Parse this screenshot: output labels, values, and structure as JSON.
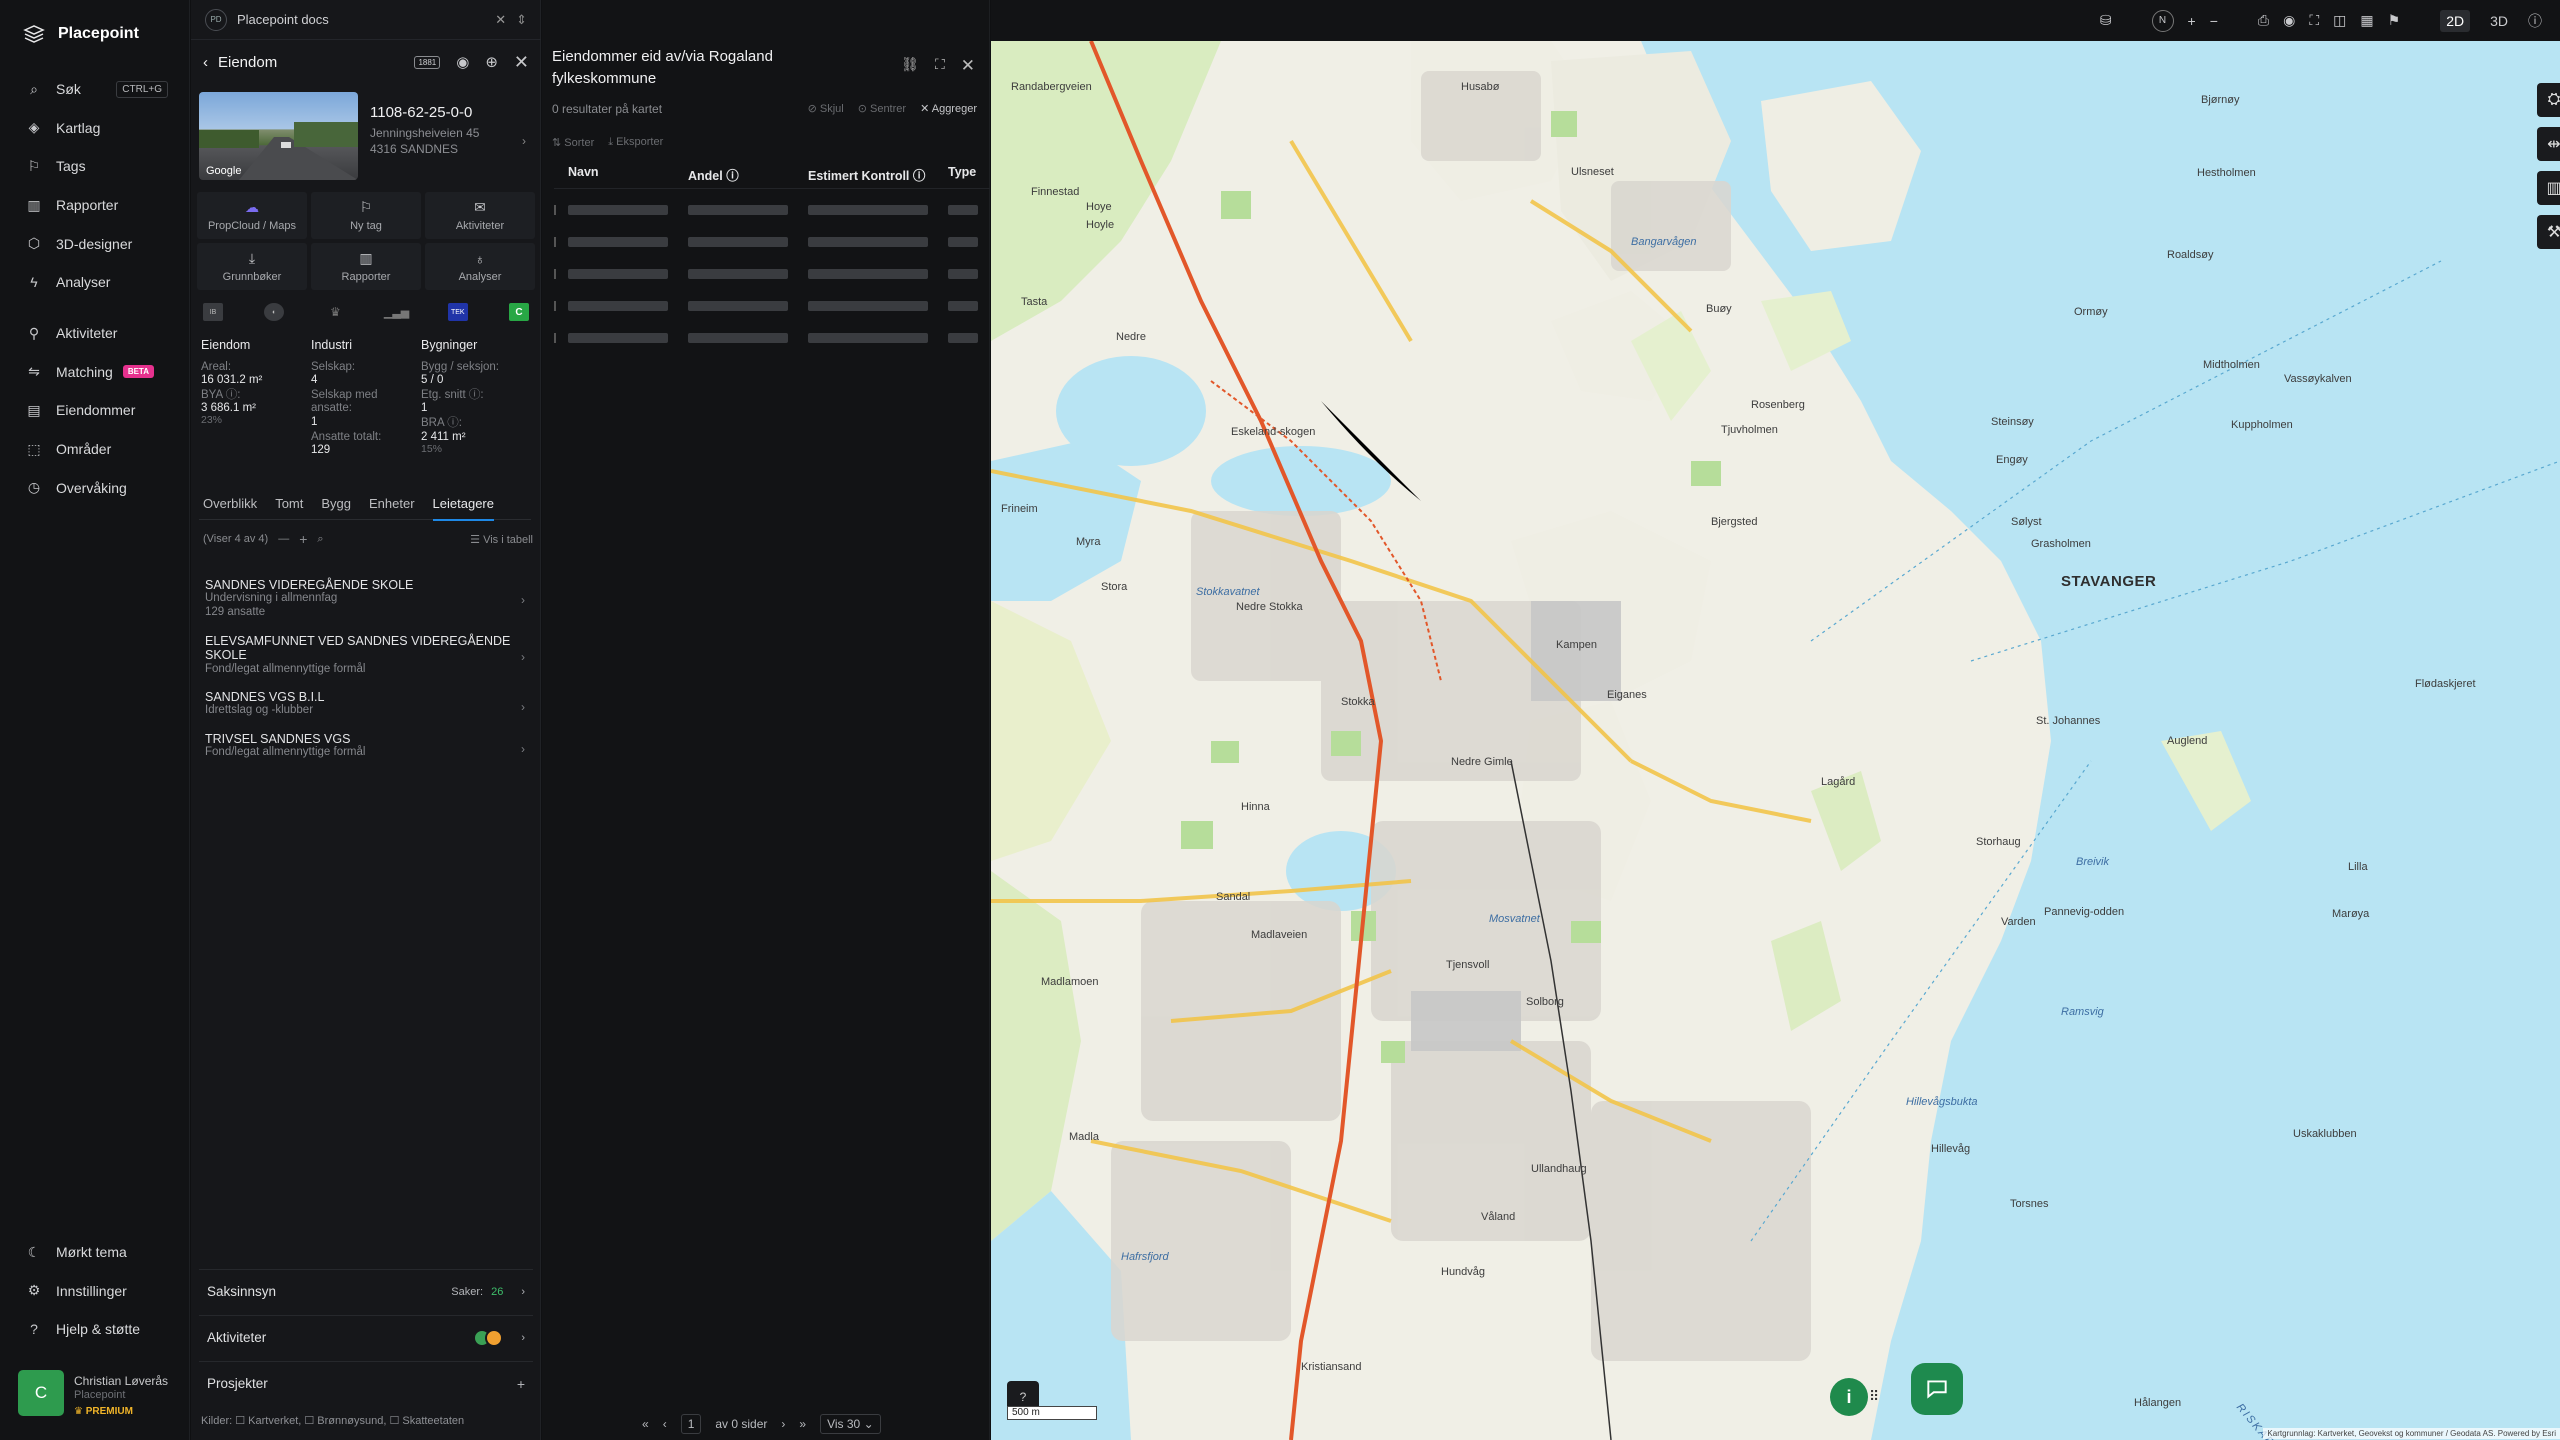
{
  "brand": "Placepoint",
  "nav": {
    "top": [
      {
        "label": "Søk",
        "icon": "search-icon",
        "kbd": "CTRL+G"
      },
      {
        "label": "Kartlag",
        "icon": "layers-icon"
      },
      {
        "label": "Tags",
        "icon": "bookmark-icon"
      },
      {
        "label": "Rapporter",
        "icon": "chart-icon"
      },
      {
        "label": "3D-designer",
        "icon": "cube-icon"
      },
      {
        "label": "Analyser",
        "icon": "bolt-icon"
      }
    ],
    "mid": [
      {
        "label": "Aktiviteter",
        "icon": "activity-icon"
      },
      {
        "label": "Matching",
        "icon": "matching-icon",
        "badge": "BETA"
      },
      {
        "label": "Eiendommer",
        "icon": "building-icon"
      },
      {
        "label": "Områder",
        "icon": "area-icon"
      },
      {
        "label": "Overvåking",
        "icon": "monitor-icon"
      }
    ],
    "bottom": [
      {
        "label": "Mørkt tema",
        "icon": "moon-icon"
      },
      {
        "label": "Innstillinger",
        "icon": "gear-icon"
      },
      {
        "label": "Hjelp & støtte",
        "icon": "help-icon"
      }
    ]
  },
  "user": {
    "initial": "C",
    "name": "Christian Løverås",
    "org": "Placepoint",
    "plan": "PREMIUM"
  },
  "docs": {
    "badge": "PD",
    "title": "Placepoint docs"
  },
  "property": {
    "header": "Eiendom",
    "badge_1881": "1881",
    "photo_label": "Google",
    "id": "1108-62-25-0-0",
    "street": "Jenningsheiveien 45",
    "postal": "4316 SANDNES",
    "tiles": [
      {
        "label": "PropCloud / Maps",
        "icon": "cloud-icon"
      },
      {
        "label": "Ny tag",
        "icon": "bookmark-icon"
      },
      {
        "label": "Aktiviteter",
        "icon": "chat-icon"
      },
      {
        "label": "Grunnbøker",
        "icon": "download-icon"
      },
      {
        "label": "Rapporter",
        "icon": "chart-icon"
      },
      {
        "label": "Analyser",
        "icon": "bulb-icon"
      }
    ],
    "src_tek": "TEK",
    "src_c": "C",
    "stats": {
      "eiendom": {
        "title": "Eiendom",
        "areal_lbl": "Areal:",
        "areal": "16 031.2 m²",
        "bya_lbl": "BYA ⓘ:",
        "bya": "3 686.1 m²",
        "bya_pct": "23%"
      },
      "industri": {
        "title": "Industri",
        "selskap_lbl": "Selskap:",
        "selskap": "4",
        "ansatte_lbl": "Selskap med ansatte:",
        "ansatte": "1",
        "totalt_lbl": "Ansatte totalt:",
        "totalt": "129"
      },
      "bygninger": {
        "title": "Bygninger",
        "bygg_lbl": "Bygg / seksjon:",
        "bygg": "5 / 0",
        "etg_lbl": "Etg. snitt ⓘ:",
        "etg": "1",
        "bra_lbl": "BRA ⓘ:",
        "bra": "2 411 m²",
        "bra_pct": "15%"
      }
    },
    "tabs": [
      "Overblikk",
      "Tomt",
      "Bygg",
      "Enheter",
      "Leietagere"
    ],
    "showing": "(Viser 4 av 4)",
    "show_table": "Vis i tabell",
    "tenants": [
      {
        "name": "SANDNES VIDEREGÅENDE SKOLE",
        "desc": "Undervisning i allmennfag",
        "extra": "129 ansatte"
      },
      {
        "name": "ELEVSAMFUNNET VED SANDNES VIDEREGÅENDE SKOLE",
        "desc": "Fond/legat allmennyttige formål",
        "extra": ""
      },
      {
        "name": "SANDNES VGS B.I.L",
        "desc": "Idrettslag og -klubber",
        "extra": ""
      },
      {
        "name": "TRIVSEL SANDNES VGS",
        "desc": "Fond/legat allmennyttige formål",
        "extra": ""
      }
    ],
    "sections": {
      "saksinnsyn": "Saksinnsyn",
      "saker_lbl": "Saker:",
      "saker": "26",
      "aktiviteter": "Aktiviteter",
      "prosjekter": "Prosjekter"
    },
    "sources": "Kilder: ☐ Kartverket, ☐ Brønnøysund, ☐ Skatteetaten"
  },
  "list": {
    "title": "Eiendommer eid av/via Rogaland fylkeskommune",
    "count": "0 resultater på kartet",
    "hide": "Skjul",
    "center": "Sentrer",
    "aggregate": "Aggreger",
    "sort": "Sorter",
    "export": "Eksporter",
    "columns": [
      "Navn",
      "Andel ⓘ",
      "Estimert Kontroll ⓘ",
      "Type"
    ],
    "pager": {
      "page": "1",
      "of": "av 0 sider",
      "show": "Vis 30"
    }
  },
  "map": {
    "labels": [
      {
        "t": "Randabergveien"
      },
      {
        "t": "Hoye"
      },
      {
        "t": "Finnestad"
      },
      {
        "t": "Hoyle"
      },
      {
        "t": "Tasta"
      },
      {
        "t": "Nedre"
      },
      {
        "t": "Eskeland-skogen"
      },
      {
        "t": "Myra"
      },
      {
        "t": "Frineim"
      },
      {
        "t": "Stora"
      },
      {
        "t": "Stokkavatnet"
      },
      {
        "t": "Nedre Stokka"
      },
      {
        "t": "Kampen"
      },
      {
        "t": "Eiganes"
      },
      {
        "t": "Stokka"
      },
      {
        "t": "Madlaveien"
      },
      {
        "t": "Mosvatnet"
      },
      {
        "t": "Madla"
      },
      {
        "t": "Hafrsfjord"
      },
      {
        "t": "Hinna"
      },
      {
        "t": "Ullandhaug"
      },
      {
        "t": "Hillevåg"
      },
      {
        "t": "Hillevågsbukta"
      },
      {
        "t": "Lagård"
      },
      {
        "t": "Storhaug"
      },
      {
        "t": "Breivik"
      },
      {
        "t": "Ramsvig"
      },
      {
        "t": "Hundvåg"
      },
      {
        "t": "Bangarvågen"
      },
      {
        "t": "Ulsneset"
      },
      {
        "t": "Buøy"
      },
      {
        "t": "Engøy"
      },
      {
        "t": "Steinsøy"
      },
      {
        "t": "Sølyst"
      },
      {
        "t": "Grasholmen"
      },
      {
        "t": "Bjergsted"
      },
      {
        "t": "Tjuvholmen"
      },
      {
        "t": "Rosenberg"
      },
      {
        "t": "Ormøy"
      },
      {
        "t": "Kuppholmen"
      },
      {
        "t": "Vassøykalven"
      },
      {
        "t": "Midtholmen"
      },
      {
        "t": "Roaldsøy"
      },
      {
        "t": "Hestholmen"
      },
      {
        "t": "Bjørnøy"
      },
      {
        "t": "Lilla"
      },
      {
        "t": "Marøya"
      },
      {
        "t": "Uskaklubben"
      },
      {
        "t": "RISKAFJORDEN"
      },
      {
        "t": "Hålangen"
      },
      {
        "t": "Torsnes"
      },
      {
        "t": "Flødaskjeret"
      },
      {
        "t": "Pannevig-odden"
      },
      {
        "t": "Madlamoen"
      },
      {
        "t": "Sandal"
      },
      {
        "t": "Tjensvoll"
      },
      {
        "t": "Solborg"
      },
      {
        "t": "Nedre Gimle"
      },
      {
        "t": "Våland"
      },
      {
        "t": "St. Johannes"
      },
      {
        "t": "Auglend"
      },
      {
        "t": "Kristiansand"
      },
      {
        "t": "Varden"
      },
      {
        "t": "Husabø"
      }
    ],
    "city": "STAVANGER",
    "scale": "500 m",
    "attribution": "Kartgrunnlag: Kartverket, Geovekst og kommuner / Geodata AS. Powered by Esri",
    "info": "i",
    "modes": [
      "2D",
      "3D"
    ],
    "north": "N"
  }
}
